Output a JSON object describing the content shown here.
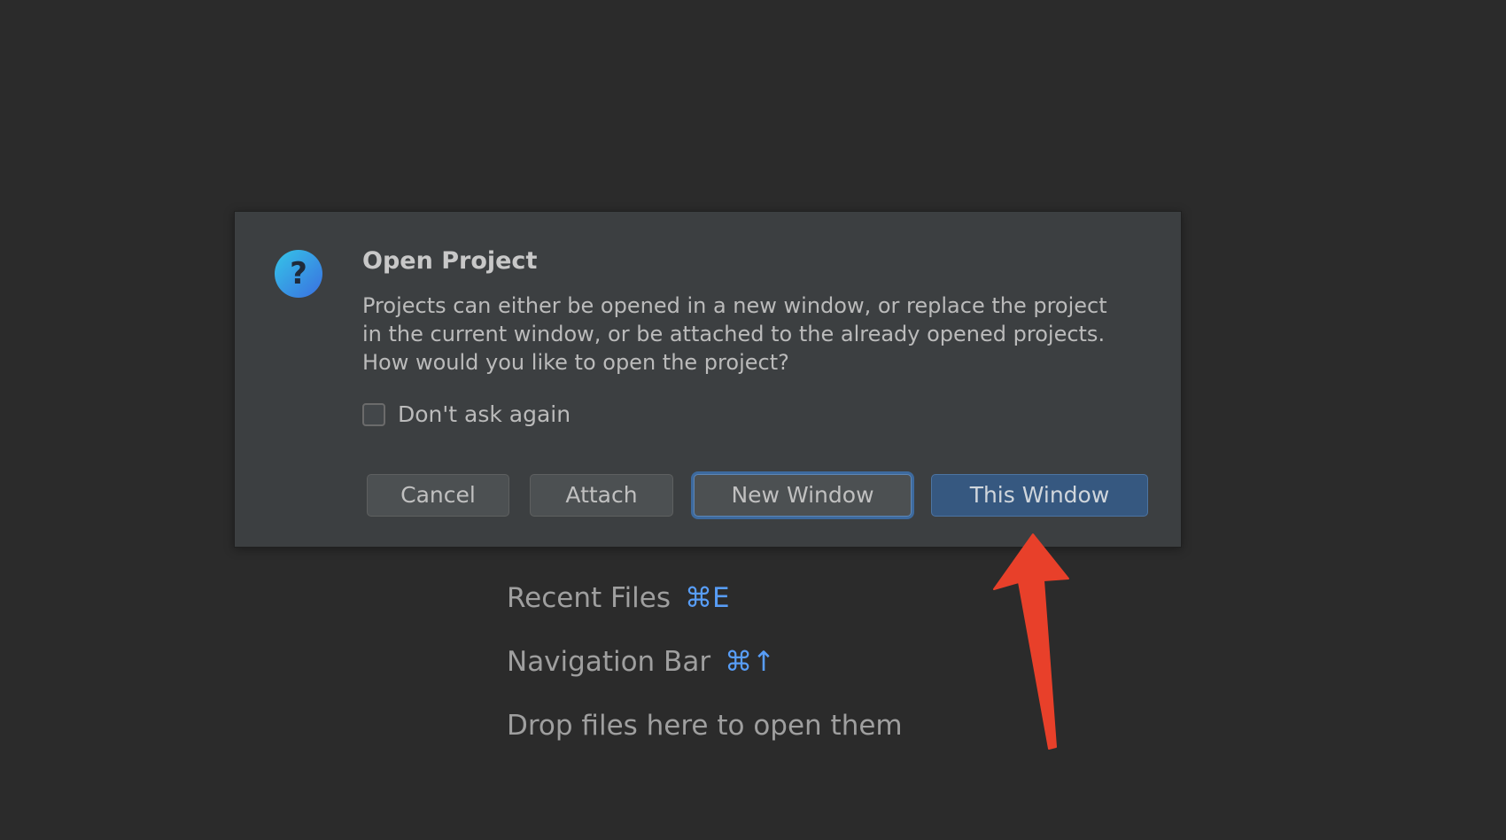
{
  "dialog": {
    "title": "Open Project",
    "message_lines": [
      "Projects can either be opened in a new window, or replace the project",
      "in the current window, or be attached to the already opened projects.",
      "How would you like to open the project?"
    ],
    "checkbox": {
      "label": "Don't ask again",
      "checked": false
    },
    "buttons": {
      "cancel": "Cancel",
      "attach": "Attach",
      "new_window": "New Window",
      "this_window": "This Window"
    },
    "icon": "question-icon"
  },
  "welcome": {
    "items": [
      {
        "label": "Recent Files",
        "shortcut": "⌘E"
      },
      {
        "label": "Navigation Bar",
        "shortcut": "⌘↑"
      },
      {
        "label": "Drop files here to open them",
        "shortcut": ""
      }
    ]
  },
  "annotation": {
    "type": "arrow",
    "color": "#e8402a",
    "target": "this-window-button"
  },
  "colors": {
    "background": "#2b2b2b",
    "dialog": "#3c3f41",
    "primary_button": "#365880",
    "shortcut": "#589df6"
  }
}
